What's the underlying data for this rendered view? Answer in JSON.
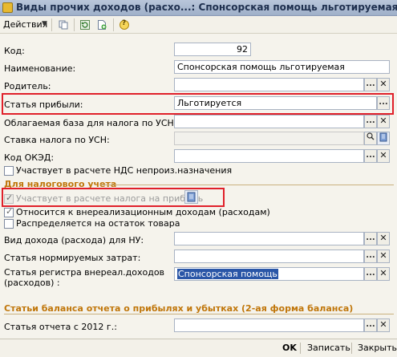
{
  "window": {
    "title": "Виды прочих доходов (расхо...: Спонсорская помощь льготируемая *"
  },
  "toolbar": {
    "actions_label": "Действия",
    "help_label": "?"
  },
  "fields": {
    "code": {
      "label": "Код:",
      "value": "92"
    },
    "name": {
      "label": "Наименование:",
      "value": "Спонсорская помощь льготируемая"
    },
    "parent": {
      "label": "Родитель:",
      "value": ""
    },
    "profit_item": {
      "label": "Статья прибыли:",
      "value": "Льготируется"
    },
    "usn_base": {
      "label": "Облагаемая база для налога по УСН:",
      "value": ""
    },
    "usn_rate": {
      "label": "Ставка налога по УСН:",
      "value": ""
    },
    "okved": {
      "label": "Код ОКЭД:",
      "value": ""
    },
    "vat_check": {
      "label": "Участвует в расчете НДС непроиз.назначения"
    }
  },
  "tax_section": {
    "title": "Для налогового учета",
    "participates_profit_tax": "Участвует в расчете налога на прибыль",
    "non_operating": "Относится к внереализационным доходам (расходам)",
    "distributed_remainder": "Распределяется на остаток товара",
    "income_type_label": "Вид дохода (расхода) для НУ:",
    "income_type_value": "",
    "normalized_cost_label": "Статья нормируемых затрат:",
    "normalized_cost_value": "",
    "register_item_label_1": "Статья регистра внереал.доходов",
    "register_item_label_2": "(расходов) :",
    "register_item_value": "Спонсорская помощь"
  },
  "balance_section": {
    "title": "Статьи баланса отчета о прибылях и убытках (2-ая форма баланса)",
    "report_item_label": "Статья отчета с 2012 г.:",
    "report_item_value": ""
  },
  "buttons": {
    "ok": "OK",
    "save": "Записать",
    "close": "Закрыть",
    "ellipsis": "...",
    "clear": "✕"
  },
  "colors": {
    "section_title": "#c0760a",
    "highlight_border": "#e0202a",
    "selection": "#2a56a7"
  }
}
